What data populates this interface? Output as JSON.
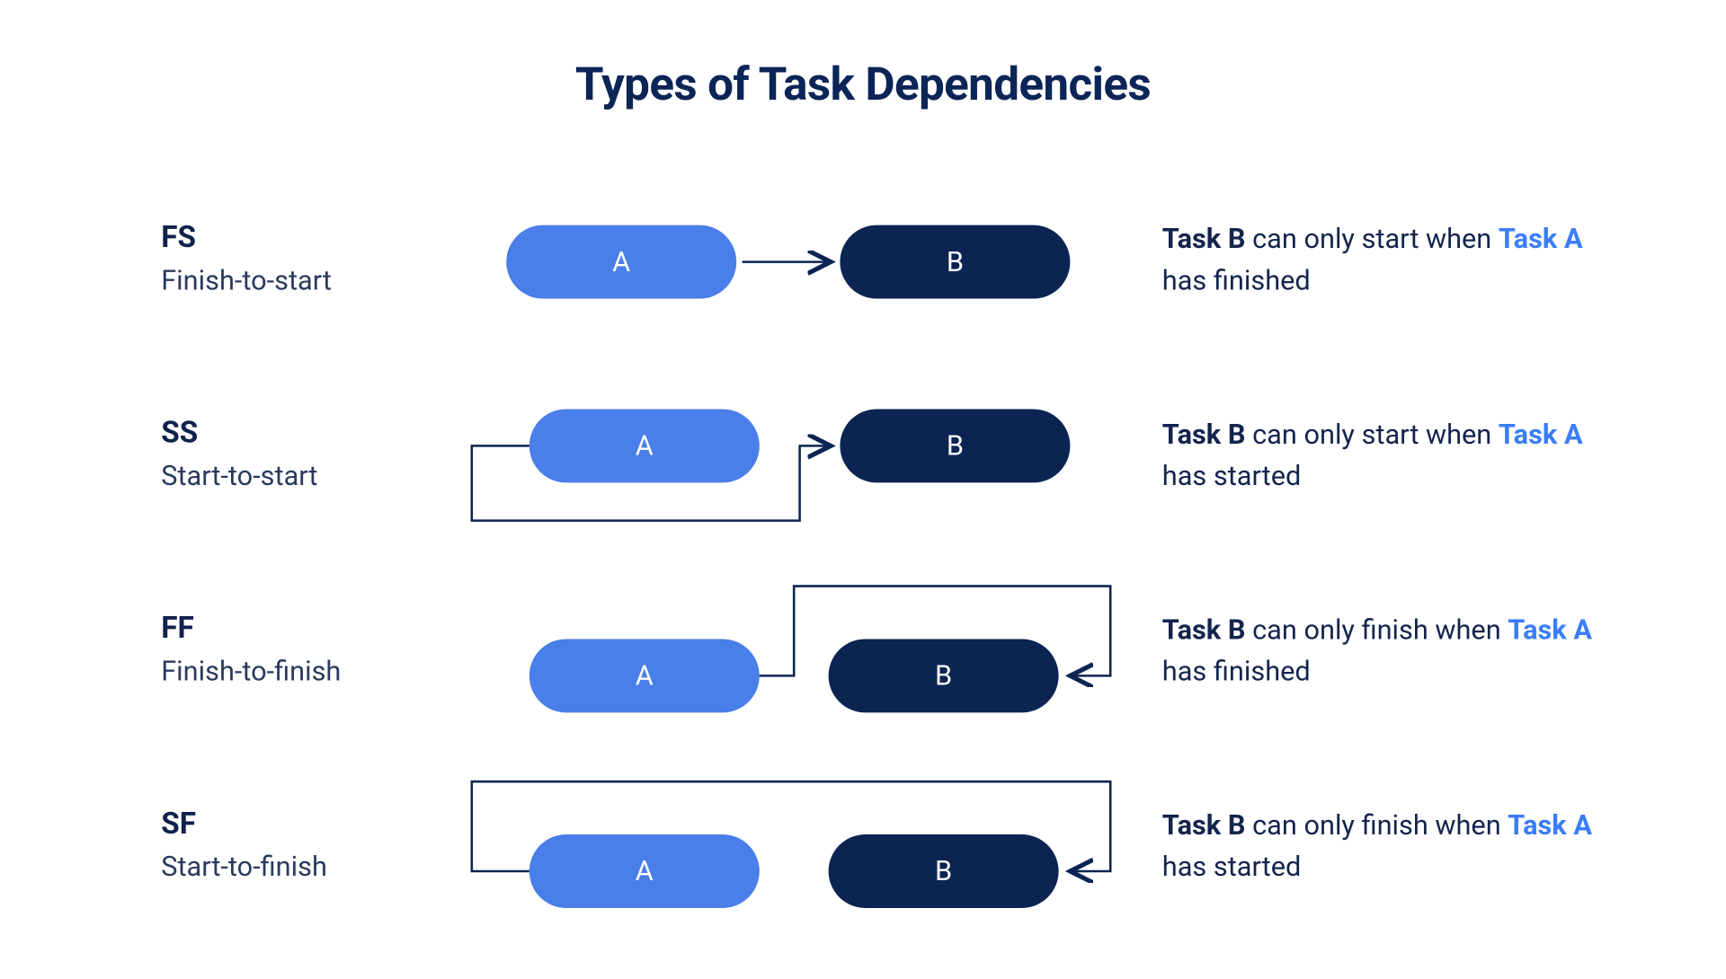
{
  "title": "Types of Task Dependencies",
  "labels": {
    "taskA": "A",
    "taskB": "B"
  },
  "rows": [
    {
      "abbr": "FS",
      "long": "Finish-to-start",
      "desc": {
        "lead": "Task B",
        "mid": " can only start when ",
        "ref": "Task A",
        "tail": " has finished"
      }
    },
    {
      "abbr": "SS",
      "long": "Start-to-start",
      "desc": {
        "lead": "Task B",
        "mid": " can only start when ",
        "ref": "Task A",
        "tail": " has started"
      }
    },
    {
      "abbr": "FF",
      "long": "Finish-to-finish",
      "desc": {
        "lead": "Task B",
        "mid": " can only finish when ",
        "ref": "Task A",
        "tail": " has finished"
      }
    },
    {
      "abbr": "SF",
      "long": "Start-to-finish",
      "desc": {
        "lead": "Task B",
        "mid": " can only finish when ",
        "ref": "Task A",
        "tail": " has started"
      }
    }
  ]
}
